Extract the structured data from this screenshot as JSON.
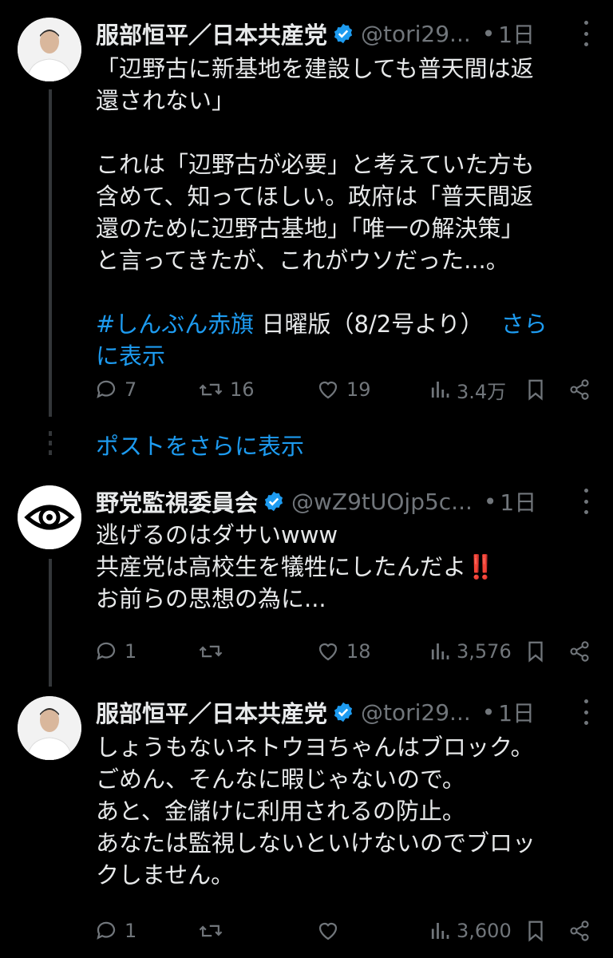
{
  "tweets": [
    {
      "name": "服部恒平／日本共産党",
      "handle": "@tori29...",
      "dot": "•",
      "time": "1日",
      "lines": [
        "「辺野古に新基地を建設しても普天間は返",
        "還されない」",
        "",
        "これは「辺野古が必要」と考えていた方も",
        "含めて、知ってほしい。政府は「普天間返",
        "還のために辺野古基地」「唯一の解決策」",
        "と言ってきたが、これがウソだった...。",
        ""
      ],
      "hashtag": "#しんぶん赤旗",
      "hashtag_after": " 日曜版（8/2号より）",
      "show_more_inline_1": "さら",
      "show_more_inline_2": "に表示",
      "replies": "7",
      "reposts": "16",
      "likes": "19",
      "views": "3.4万"
    },
    {
      "name": "野党監視委員会",
      "handle": "@wZ9tUOjp5c...",
      "dot": "•",
      "time": "1日",
      "lines": [
        "逃げるのはダサいwww",
        "共産党は高校生を犠牲にしたんだよ‼️",
        "お前らの思想の為に..."
      ],
      "replies": "1",
      "reposts": "",
      "likes": "18",
      "views": "3,576"
    },
    {
      "name": "服部恒平／日本共産党",
      "handle": "@tori29...",
      "dot": "•",
      "time": "1日",
      "lines": [
        "しょうもないネトウヨちゃんはブロック。",
        "ごめん、そんなに暇じゃないので。",
        "あと、金儲けに利用されるの防止。",
        "あなたは監視しないといけないのでブロッ",
        "クしません。"
      ],
      "replies": "1",
      "reposts": "",
      "likes": "",
      "views": "3,600"
    }
  ],
  "show_more_posts": "ポストをさらに表示",
  "colors": {
    "background": "#000000",
    "text": "#e7e9ea",
    "secondary": "#71767b",
    "link": "#1d9bf0",
    "verified": "#1d9bf0",
    "thread_line": "#333639"
  },
  "icons": [
    "verified-badge-icon",
    "more-icon",
    "reply-icon",
    "repost-icon",
    "like-icon",
    "views-icon",
    "bookmark-icon",
    "share-icon",
    "eye-icon"
  ]
}
